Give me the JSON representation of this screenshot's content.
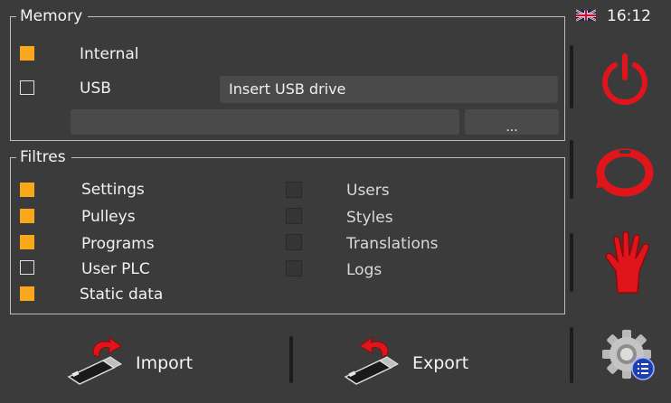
{
  "memory": {
    "title": "Memory",
    "internal_label": "Internal",
    "internal_checked": true,
    "usb_label": "USB",
    "usb_checked": false,
    "usb_status": "Insert USB drive",
    "path_value": "",
    "browse_label": "..."
  },
  "filters": {
    "title": "Filtres",
    "left": [
      {
        "label": "Settings",
        "checked": true
      },
      {
        "label": "Pulleys",
        "checked": true
      },
      {
        "label": "Programs",
        "checked": true
      },
      {
        "label": "User PLC",
        "checked": false
      },
      {
        "label": "Static data",
        "checked": true
      }
    ],
    "right": [
      {
        "label": "Users",
        "checked": false
      },
      {
        "label": "Styles",
        "checked": false
      },
      {
        "label": "Translations",
        "checked": false
      },
      {
        "label": "Logs",
        "checked": false
      }
    ]
  },
  "actions": {
    "import_label": "Import",
    "export_label": "Export"
  },
  "status": {
    "flag": "uk-flag-icon",
    "time": "16:12"
  },
  "side_buttons": [
    "power-icon",
    "refresh-icon",
    "stop-hand-icon",
    "settings-gear-icon"
  ],
  "colors": {
    "checked": "#f7a81b",
    "accent_red": "#e0151b",
    "background": "#3b3b3b"
  }
}
